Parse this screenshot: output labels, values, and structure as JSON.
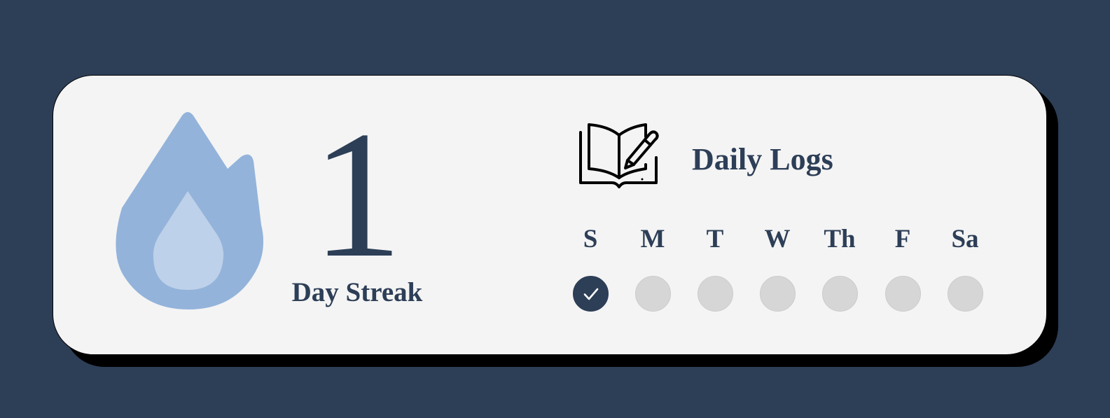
{
  "streak": {
    "count": "1",
    "label": "Day Streak",
    "icon": "flame-icon"
  },
  "logs": {
    "title": "Daily Logs",
    "icon": "book-pencil-icon"
  },
  "week": [
    {
      "label": "S",
      "done": true
    },
    {
      "label": "M",
      "done": false
    },
    {
      "label": "T",
      "done": false
    },
    {
      "label": "W",
      "done": false
    },
    {
      "label": "Th",
      "done": false
    },
    {
      "label": "F",
      "done": false
    },
    {
      "label": "Sa",
      "done": false
    }
  ],
  "colors": {
    "background": "#2d3e57",
    "card": "#f4f4f4",
    "flame_outer": "#93b3da",
    "flame_inner": "#bed1ea",
    "dot_empty": "#d6d6d6",
    "dot_done": "#2d3e57"
  }
}
